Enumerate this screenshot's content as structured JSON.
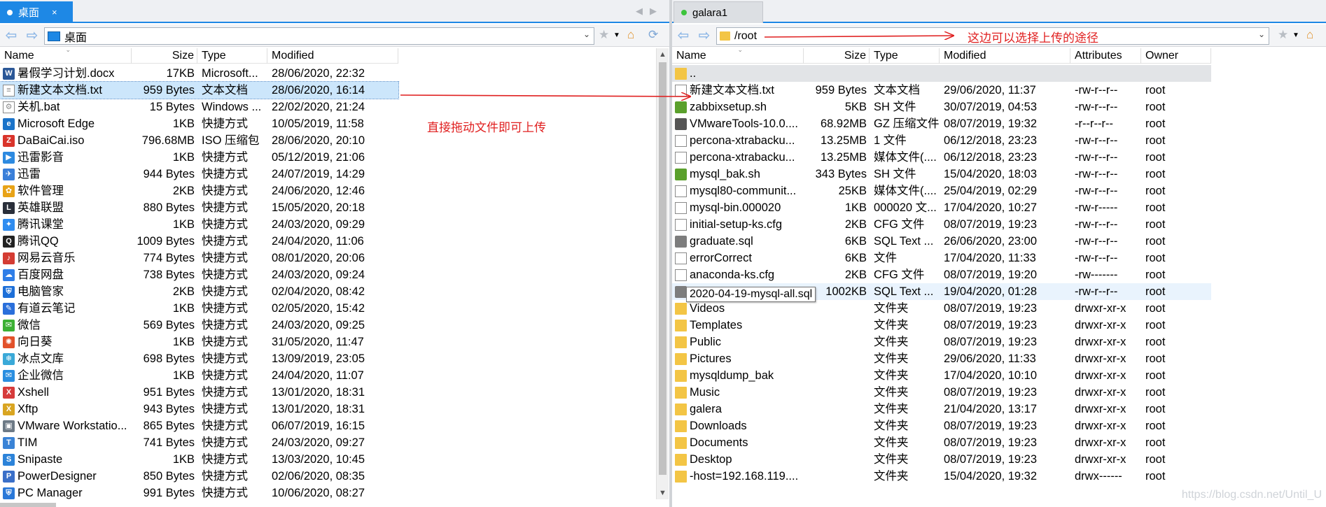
{
  "left": {
    "tab": {
      "label": "桌面",
      "close": "×"
    },
    "address": "桌面",
    "columns": {
      "name": "Name",
      "size": "Size",
      "type": "Type",
      "modified": "Modified"
    },
    "files": [
      {
        "name": "暑假学习计划.docx",
        "size": "17KB",
        "type": "Microsoft...",
        "modified": "28/06/2020, 22:32",
        "icon": "word-icon",
        "color": "#2b5797",
        "glyph": "W"
      },
      {
        "name": "新建文本文档.txt",
        "size": "959 Bytes",
        "type": "文本文档",
        "modified": "28/06/2020, 16:14",
        "icon": "text-file-icon",
        "color": "doc",
        "glyph": "≡"
      },
      {
        "name": "关机.bat",
        "size": "15 Bytes",
        "type": "Windows ...",
        "modified": "22/02/2020, 21:24",
        "icon": "batch-file-icon",
        "color": "doc",
        "glyph": "⚙"
      },
      {
        "name": "Microsoft Edge",
        "size": "1KB",
        "type": "快捷方式",
        "modified": "10/05/2019, 11:58",
        "icon": "edge-icon",
        "color": "#1a73c9",
        "glyph": "e"
      },
      {
        "name": "DaBaiCai.iso",
        "size": "796.68MB",
        "type": "ISO 压缩包",
        "modified": "28/06/2020, 20:10",
        "icon": "iso-archive-icon",
        "color": "#d9342b",
        "glyph": "Z"
      },
      {
        "name": "迅雷影音",
        "size": "1KB",
        "type": "快捷方式",
        "modified": "05/12/2019, 21:06",
        "icon": "thunder-player-icon",
        "color": "#2d8ae0",
        "glyph": "▶"
      },
      {
        "name": "迅雷",
        "size": "944 Bytes",
        "type": "快捷方式",
        "modified": "24/07/2019, 14:29",
        "icon": "thunder-icon",
        "color": "#3a7fd9",
        "glyph": "✈"
      },
      {
        "name": "软件管理",
        "size": "2KB",
        "type": "快捷方式",
        "modified": "24/06/2020, 12:46",
        "icon": "software-manager-icon",
        "color": "#e8a317",
        "glyph": "✿"
      },
      {
        "name": "英雄联盟",
        "size": "880 Bytes",
        "type": "快捷方式",
        "modified": "15/05/2020, 20:18",
        "icon": "lol-icon",
        "color": "#2a2f3a",
        "glyph": "L"
      },
      {
        "name": "腾讯课堂",
        "size": "1KB",
        "type": "快捷方式",
        "modified": "24/03/2020, 09:29",
        "icon": "tencent-classroom-icon",
        "color": "#2f8cf0",
        "glyph": "✦"
      },
      {
        "name": "腾讯QQ",
        "size": "1009 Bytes",
        "type": "快捷方式",
        "modified": "24/04/2020, 11:06",
        "icon": "qq-icon",
        "color": "#222",
        "glyph": "Q"
      },
      {
        "name": "网易云音乐",
        "size": "774 Bytes",
        "type": "快捷方式",
        "modified": "08/01/2020, 20:06",
        "icon": "netease-music-icon",
        "color": "#d43c33",
        "glyph": "♪"
      },
      {
        "name": "百度网盘",
        "size": "738 Bytes",
        "type": "快捷方式",
        "modified": "24/03/2020, 09:24",
        "icon": "baidu-netdisk-icon",
        "color": "#2f7ee8",
        "glyph": "☁"
      },
      {
        "name": "电脑管家",
        "size": "2KB",
        "type": "快捷方式",
        "modified": "02/04/2020, 08:42",
        "icon": "pc-manager-icon",
        "color": "#1d6fd8",
        "glyph": "⛨"
      },
      {
        "name": "有道云笔记",
        "size": "1KB",
        "type": "快捷方式",
        "modified": "02/05/2020, 15:42",
        "icon": "youdao-note-icon",
        "color": "#2a6fdb",
        "glyph": "✎"
      },
      {
        "name": "微信",
        "size": "569 Bytes",
        "type": "快捷方式",
        "modified": "24/03/2020, 09:25",
        "icon": "wechat-icon",
        "color": "#3cb034",
        "glyph": "✉"
      },
      {
        "name": "向日葵",
        "size": "1KB",
        "type": "快捷方式",
        "modified": "31/05/2020, 11:47",
        "icon": "sunflower-icon",
        "color": "#e2512a",
        "glyph": "✺"
      },
      {
        "name": "冰点文库",
        "size": "698 Bytes",
        "type": "快捷方式",
        "modified": "13/09/2019, 23:05",
        "icon": "bingdian-icon",
        "color": "#3aa9d8",
        "glyph": "❄"
      },
      {
        "name": "企业微信",
        "size": "1KB",
        "type": "快捷方式",
        "modified": "24/04/2020, 11:07",
        "icon": "wecom-icon",
        "color": "#2a8ee0",
        "glyph": "✉"
      },
      {
        "name": "Xshell",
        "size": "951 Bytes",
        "type": "快捷方式",
        "modified": "13/01/2020, 18:31",
        "icon": "xshell-icon",
        "color": "#d63b3b",
        "glyph": "X"
      },
      {
        "name": "Xftp",
        "size": "943 Bytes",
        "type": "快捷方式",
        "modified": "13/01/2020, 18:31",
        "icon": "xftp-icon",
        "color": "#d9a521",
        "glyph": "X"
      },
      {
        "name": "VMware Workstatio...",
        "size": "865 Bytes",
        "type": "快捷方式",
        "modified": "06/07/2019, 16:15",
        "icon": "vmware-icon",
        "color": "#6d7a86",
        "glyph": "▣"
      },
      {
        "name": "TIM",
        "size": "741 Bytes",
        "type": "快捷方式",
        "modified": "24/03/2020, 09:27",
        "icon": "tim-icon",
        "color": "#3a83d6",
        "glyph": "T"
      },
      {
        "name": "Snipaste",
        "size": "1KB",
        "type": "快捷方式",
        "modified": "13/03/2020, 10:45",
        "icon": "snipaste-icon",
        "color": "#2c83d9",
        "glyph": "S"
      },
      {
        "name": "PowerDesigner",
        "size": "850 Bytes",
        "type": "快捷方式",
        "modified": "02/06/2020, 08:35",
        "icon": "powerdesigner-icon",
        "color": "#3a6fc8",
        "glyph": "P"
      },
      {
        "name": "PC Manager",
        "size": "991 Bytes",
        "type": "快捷方式",
        "modified": "10/06/2020, 08:27",
        "icon": "pc-manager-icon",
        "color": "#2a78d8",
        "glyph": "⛨"
      }
    ]
  },
  "right": {
    "tab": {
      "label": "galara1"
    },
    "address": "/root",
    "columns": {
      "name": "Name",
      "size": "Size",
      "type": "Type",
      "modified": "Modified",
      "attributes": "Attributes",
      "owner": "Owner"
    },
    "files": [
      {
        "name": "..",
        "size": "",
        "type": "",
        "modified": "",
        "attributes": "",
        "owner": "",
        "icon": "folder-up-icon",
        "color": "folder"
      },
      {
        "name": "新建文本文档.txt",
        "size": "959 Bytes",
        "type": "文本文档",
        "modified": "29/06/2020, 11:37",
        "attributes": "-rw-r--r--",
        "owner": "root",
        "icon": "text-file-icon",
        "color": "doc"
      },
      {
        "name": "zabbixsetup.sh",
        "size": "5KB",
        "type": "SH 文件",
        "modified": "30/07/2019, 04:53",
        "attributes": "-rw-r--r--",
        "owner": "root",
        "icon": "script-icon",
        "color": "#5aa02c"
      },
      {
        "name": "VMwareTools-10.0....",
        "size": "68.92MB",
        "type": "GZ 压缩文件",
        "modified": "08/07/2019, 19:32",
        "attributes": "-r--r--r--",
        "owner": "root",
        "icon": "archive-icon",
        "color": "#555"
      },
      {
        "name": "percona-xtrabacku...",
        "size": "13.25MB",
        "type": "1 文件",
        "modified": "06/12/2018, 23:23",
        "attributes": "-rw-r--r--",
        "owner": "root",
        "icon": "file-icon",
        "color": "doc"
      },
      {
        "name": "percona-xtrabacku...",
        "size": "13.25MB",
        "type": "媒体文件(....",
        "modified": "06/12/2018, 23:23",
        "attributes": "-rw-r--r--",
        "owner": "root",
        "icon": "file-icon",
        "color": "doc"
      },
      {
        "name": "mysql_bak.sh",
        "size": "343 Bytes",
        "type": "SH 文件",
        "modified": "15/04/2020, 18:03",
        "attributes": "-rw-r--r--",
        "owner": "root",
        "icon": "script-icon",
        "color": "#5aa02c"
      },
      {
        "name": "mysql80-communit...",
        "size": "25KB",
        "type": "媒体文件(....",
        "modified": "25/04/2019, 02:29",
        "attributes": "-rw-r--r--",
        "owner": "root",
        "icon": "file-icon",
        "color": "doc"
      },
      {
        "name": "mysql-bin.000020",
        "size": "1KB",
        "type": "000020 文...",
        "modified": "17/04/2020, 10:27",
        "attributes": "-rw-r-----",
        "owner": "root",
        "icon": "file-icon",
        "color": "doc"
      },
      {
        "name": "initial-setup-ks.cfg",
        "size": "2KB",
        "type": "CFG 文件",
        "modified": "08/07/2019, 19:23",
        "attributes": "-rw-r--r--",
        "owner": "root",
        "icon": "file-icon",
        "color": "doc"
      },
      {
        "name": "graduate.sql",
        "size": "6KB",
        "type": "SQL Text ...",
        "modified": "26/06/2020, 23:00",
        "attributes": "-rw-r--r--",
        "owner": "root",
        "icon": "sql-file-icon",
        "color": "#7d7d7d"
      },
      {
        "name": "errorCorrect",
        "size": "6KB",
        "type": "文件",
        "modified": "17/04/2020, 11:33",
        "attributes": "-rw-r--r--",
        "owner": "root",
        "icon": "file-icon",
        "color": "doc"
      },
      {
        "name": "anaconda-ks.cfg",
        "size": "2KB",
        "type": "CFG 文件",
        "modified": "08/07/2019, 19:20",
        "attributes": "-rw-------",
        "owner": "root",
        "icon": "file-icon",
        "color": "doc"
      },
      {
        "name": "",
        "size": "1002KB",
        "type": "SQL Text ...",
        "modified": "19/04/2020, 01:28",
        "attributes": "-rw-r--r--",
        "owner": "root",
        "icon": "sql-file-icon",
        "color": "#7d7d7d"
      },
      {
        "name": "Videos",
        "size": "",
        "type": "文件夹",
        "modified": "08/07/2019, 19:23",
        "attributes": "drwxr-xr-x",
        "owner": "root",
        "icon": "folder-icon",
        "color": "folder"
      },
      {
        "name": "Templates",
        "size": "",
        "type": "文件夹",
        "modified": "08/07/2019, 19:23",
        "attributes": "drwxr-xr-x",
        "owner": "root",
        "icon": "folder-icon",
        "color": "folder"
      },
      {
        "name": "Public",
        "size": "",
        "type": "文件夹",
        "modified": "08/07/2019, 19:23",
        "attributes": "drwxr-xr-x",
        "owner": "root",
        "icon": "folder-icon",
        "color": "folder"
      },
      {
        "name": "Pictures",
        "size": "",
        "type": "文件夹",
        "modified": "29/06/2020, 11:33",
        "attributes": "drwxr-xr-x",
        "owner": "root",
        "icon": "folder-icon",
        "color": "folder"
      },
      {
        "name": "mysqldump_bak",
        "size": "",
        "type": "文件夹",
        "modified": "17/04/2020, 10:10",
        "attributes": "drwxr-xr-x",
        "owner": "root",
        "icon": "folder-icon",
        "color": "folder"
      },
      {
        "name": "Music",
        "size": "",
        "type": "文件夹",
        "modified": "08/07/2019, 19:23",
        "attributes": "drwxr-xr-x",
        "owner": "root",
        "icon": "folder-icon",
        "color": "folder"
      },
      {
        "name": "galera",
        "size": "",
        "type": "文件夹",
        "modified": "21/04/2020, 13:17",
        "attributes": "drwxr-xr-x",
        "owner": "root",
        "icon": "folder-icon",
        "color": "folder"
      },
      {
        "name": "Downloads",
        "size": "",
        "type": "文件夹",
        "modified": "08/07/2019, 19:23",
        "attributes": "drwxr-xr-x",
        "owner": "root",
        "icon": "folder-icon",
        "color": "folder"
      },
      {
        "name": "Documents",
        "size": "",
        "type": "文件夹",
        "modified": "08/07/2019, 19:23",
        "attributes": "drwxr-xr-x",
        "owner": "root",
        "icon": "folder-icon",
        "color": "folder"
      },
      {
        "name": "Desktop",
        "size": "",
        "type": "文件夹",
        "modified": "08/07/2019, 19:23",
        "attributes": "drwxr-xr-x",
        "owner": "root",
        "icon": "folder-icon",
        "color": "folder"
      },
      {
        "name": "-host=192.168.119....",
        "size": "",
        "type": "文件夹",
        "modified": "15/04/2020, 19:32",
        "attributes": "drwx------",
        "owner": "root",
        "icon": "folder-icon",
        "color": "folder"
      }
    ],
    "tooltip": "2020-04-19-mysql-all.sql"
  },
  "annotations": {
    "drag_hint": "直接拖动文件即可上传",
    "path_hint": "这边可以选择上传的途径"
  },
  "watermark": "https://blog.csdn.net/Until_U",
  "colors": {
    "accent": "#1e88e5",
    "annotation": "#e02020",
    "folder": "#f3c545",
    "connected_dot": "#3cc43c"
  }
}
